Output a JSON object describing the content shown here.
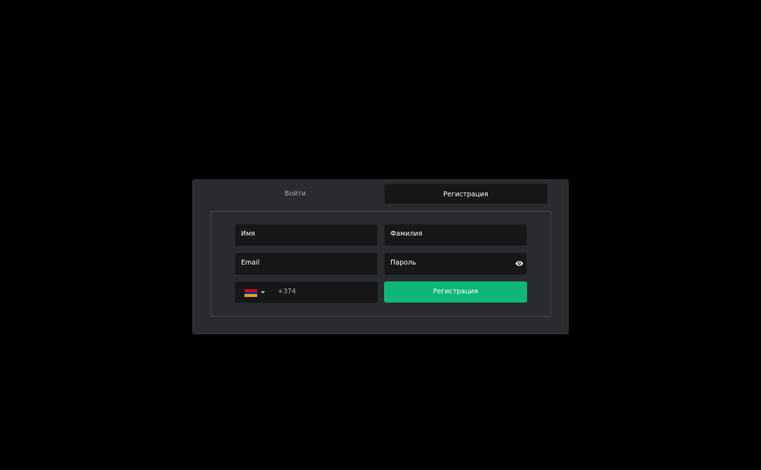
{
  "tabs": {
    "login_label": "Войти",
    "register_label": "Регистрация",
    "active": "register"
  },
  "form": {
    "first_name_placeholder": "Имя",
    "last_name_placeholder": "Фамилия",
    "email_placeholder": "Email",
    "password_placeholder": "Пароль",
    "password_toggle_icon": "eye-icon",
    "phone": {
      "country_flag": "armenia-flag-icon",
      "flag_colors": [
        "#d90012",
        "#0033a0",
        "#f2a800"
      ],
      "dropdown_icon": "caret-down-icon",
      "dial_code": "+374"
    },
    "submit_label": "Регистрация"
  },
  "colors": {
    "background": "#000000",
    "modal": "#2a2b2f",
    "input": "#161718",
    "accent": "#0eb677"
  }
}
